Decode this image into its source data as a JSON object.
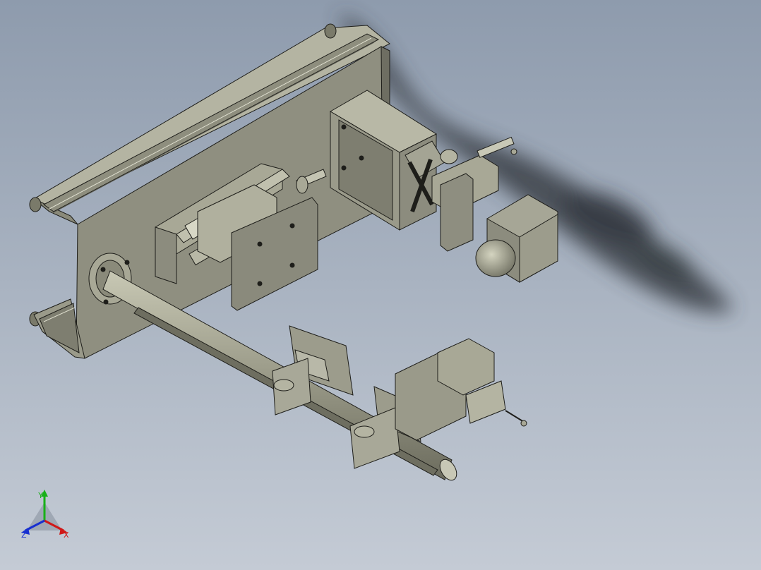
{
  "viewport": {
    "background_top": "#8e9bad",
    "background_bottom": "#c4cbd5",
    "model_face_color": "#9d9d8c",
    "model_edge_color": "#1e1e1a"
  },
  "triad": {
    "x_label": "X",
    "y_label": "Y",
    "z_label": "Z",
    "x_color": "#d01818",
    "y_color": "#18b018",
    "z_color": "#1830d0"
  }
}
